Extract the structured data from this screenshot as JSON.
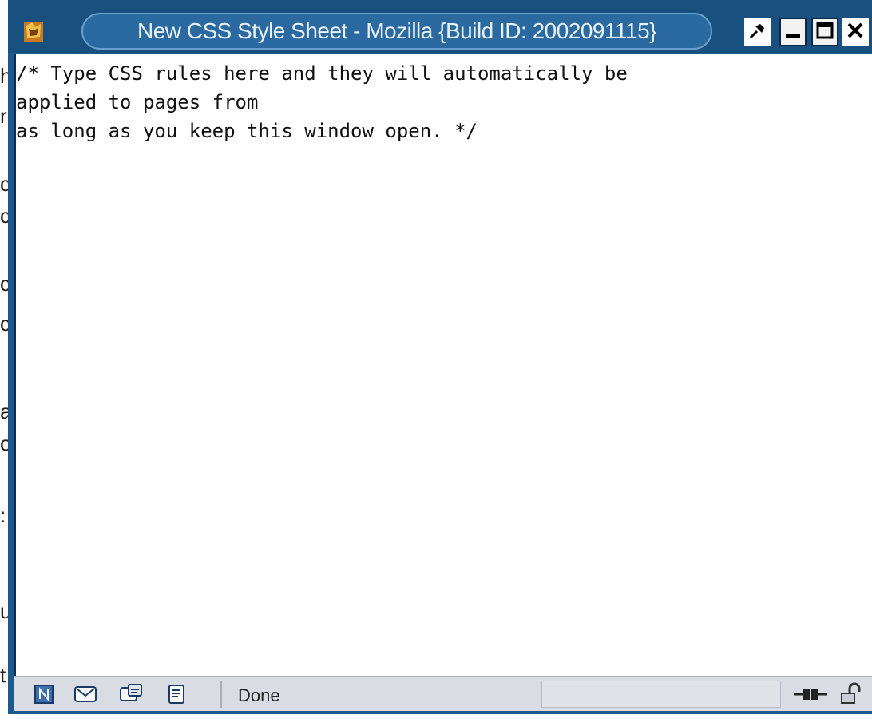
{
  "window": {
    "title": "New CSS Style Sheet - Mozilla {Build ID: 2002091115}"
  },
  "editor": {
    "content": "/* Type CSS rules here and they will automatically be\napplied to pages from\nas long as you keep this window open. */"
  },
  "status_bar": {
    "status_text": "Done"
  },
  "colors": {
    "titlebar": "#18507f",
    "title_pill": "#2a6aa0",
    "window_frame": "#1d5a8c",
    "statusbar": "#d9dde3"
  },
  "icons": {
    "app": "mozilla-app-icon",
    "pin": "pin-icon",
    "minimize": "minimize-icon",
    "maximize": "maximize-icon",
    "close": "close-icon",
    "navigator": "navigator-icon",
    "mail": "mail-icon",
    "composer": "composer-icon",
    "address_book": "address-book-icon",
    "connection": "connection-icon",
    "security": "security-lock-icon"
  }
}
